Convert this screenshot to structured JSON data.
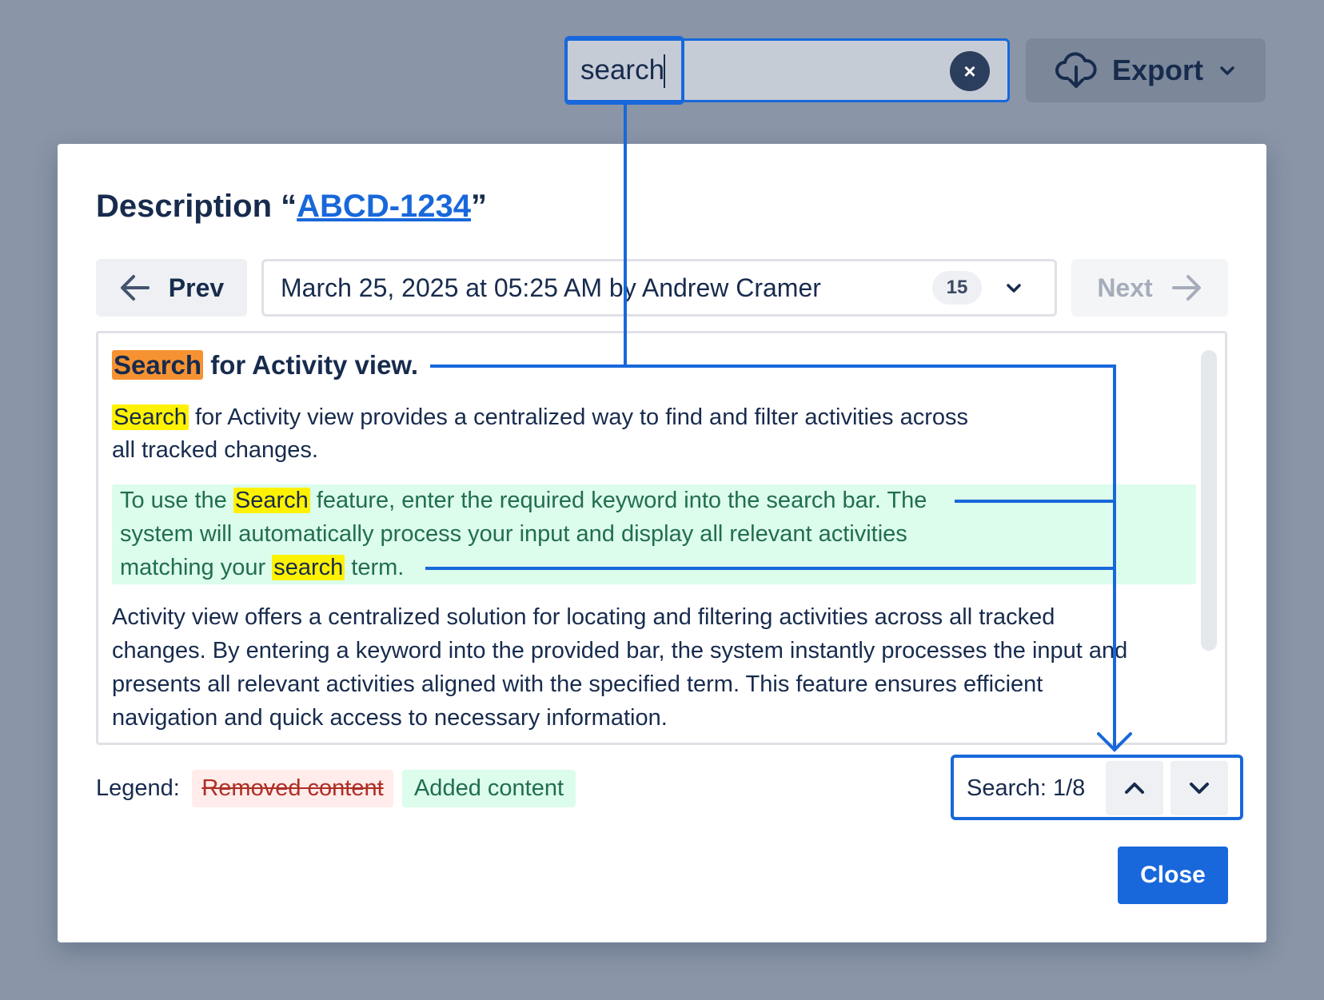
{
  "search": {
    "value": "search",
    "clear_icon": "×"
  },
  "export": {
    "label": "Export",
    "icon": "cloud-download-icon"
  },
  "dialog": {
    "title_prefix": "Description “",
    "issue_key": "ABCD-1234",
    "title_suffix": "”"
  },
  "nav": {
    "prev_label": "Prev",
    "next_label": "Next",
    "version_label": "March 25, 2025 at 05:25 AM by Andrew Cramer",
    "version_count": "15"
  },
  "content": {
    "heading_match": "Search",
    "heading_rest": " for Activity view.",
    "p1_match": "Search",
    "p1_line1_rest": " for Activity view provides a centralized way to find and filter activities across",
    "p1_line2": "all tracked changes.",
    "added_line1_pre": "To use the ",
    "added_line1_match": "Search",
    "added_line1_post": " feature, enter the required keyword into the search bar. The",
    "added_line2": "system will automatically process your input and display all relevant activities",
    "added_line3_pre": "matching your ",
    "added_line3_match": "search",
    "added_line3_post": " term.",
    "p3_line1": "Activity view offers a centralized solution for locating and filtering activities across all tracked",
    "p3_line2": "changes. By entering a keyword into the provided bar, the system instantly processes the input and",
    "p3_line3": "presents all relevant activities aligned with the specified term. This feature ensures efficient",
    "p3_line4": "navigation and quick access to necessary information."
  },
  "legend": {
    "label": "Legend:",
    "removed": "Removed content",
    "added": "Added content"
  },
  "search_nav": {
    "counter": "Search: 1/8"
  },
  "close_label": "Close",
  "colors": {
    "accent": "#1868db",
    "highlight": "#fff200",
    "current_highlight": "#f79232",
    "added_bg": "#dcfcec",
    "added_text": "#216e4e",
    "removed_bg": "#ffeceb",
    "removed_text": "#ae2e24"
  }
}
